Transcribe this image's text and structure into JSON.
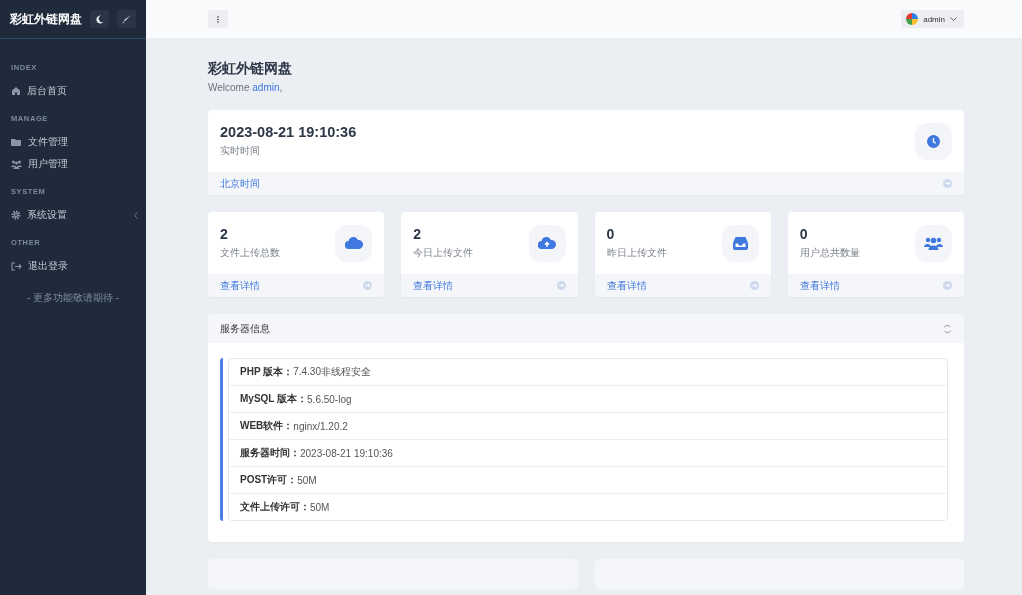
{
  "sidebar": {
    "brand": "彩虹外链网盘",
    "sections": [
      {
        "heading": "INDEX",
        "items": [
          {
            "label": "后台首页",
            "has_submenu": false
          }
        ]
      },
      {
        "heading": "MANAGE",
        "items": [
          {
            "label": "文件管理",
            "has_submenu": false
          },
          {
            "label": "用户管理",
            "has_submenu": false
          }
        ]
      },
      {
        "heading": "SYSTEM",
        "items": [
          {
            "label": "系统设置",
            "has_submenu": true
          }
        ]
      },
      {
        "heading": "OTHER",
        "items": [
          {
            "label": "退出登录",
            "has_submenu": false
          }
        ]
      }
    ],
    "footer": "- 更多功能敬请期待 -"
  },
  "header": {
    "user": "admin"
  },
  "page": {
    "title": "彩虹外链网盘",
    "welcome_prefix": "Welcome",
    "welcome_user": "admin",
    "welcome_suffix": ","
  },
  "clock": {
    "time": "2023-08-21 19:10:36",
    "label": "实时时间",
    "link": "北京时间"
  },
  "stats": [
    {
      "value": "2",
      "label": "文件上传总数",
      "link": "查看详情"
    },
    {
      "value": "2",
      "label": "今日上传文件",
      "link": "查看详情"
    },
    {
      "value": "0",
      "label": "昨日上传文件",
      "link": "查看详情"
    },
    {
      "value": "0",
      "label": "用户总共数量",
      "link": "查看详情"
    }
  ],
  "server": {
    "title": "服务器信息",
    "rows": [
      "**PHP 版本：**7.4.30非线程安全",
      "**MySQL 版本：**5.6.50-log",
      "**WEB软件：**nginx/1.20.2",
      "**服务器时间：**2023-08-21 19:10:36",
      "**POST许可：**50M",
      "**文件上传许可：**50M"
    ]
  }
}
